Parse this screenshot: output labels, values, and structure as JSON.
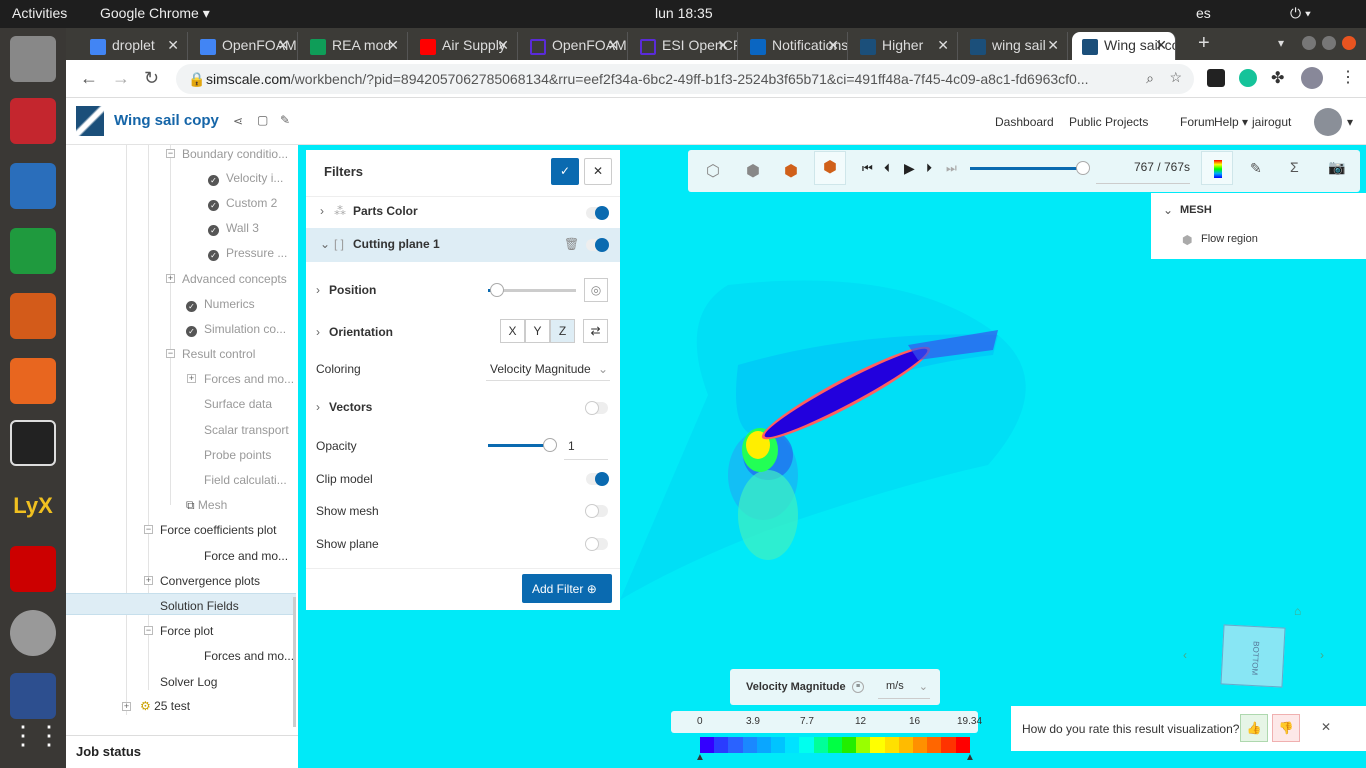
{
  "system": {
    "activities": "Activities",
    "app": "Google Chrome",
    "clock": "lun 18:35",
    "lang": "es"
  },
  "tabs": [
    {
      "label": "droplet",
      "color": "#4285f4"
    },
    {
      "label": "OpenFOAM",
      "color": "#4285f4"
    },
    {
      "label": "REA mod",
      "color": "#0f9d58"
    },
    {
      "label": "Air Supply",
      "color": "#ff0000"
    },
    {
      "label": "OpenFOAM",
      "color": "#5a2bd8"
    },
    {
      "label": "ESI OpenCFD",
      "color": "#5a2bd8"
    },
    {
      "label": "Notifications",
      "color": "#0a66c2"
    },
    {
      "label": "Higher",
      "color": "#1b4f7a"
    },
    {
      "label": "wing sail",
      "color": "#1b4f7a"
    },
    {
      "label": "Wing sail copy",
      "color": "#1b4f7a"
    }
  ],
  "browser": {
    "url_host": "simscale.com",
    "url_path": "/workbench/?pid=8942057062785068134&rru=eef2f34a-6bc2-49ff-b1f3-2524b3f65b71&ci=491ff48a-7f45-4c09-a8c1-fd6963cf0..."
  },
  "header": {
    "project": "Wing sail copy",
    "nav": [
      "Dashboard",
      "Public Projects",
      "Forum",
      "Help"
    ],
    "user": "jairogut"
  },
  "tree": {
    "boundary": "Boundary conditio...",
    "bc_items": [
      "Velocity i...",
      "Custom 2",
      "Wall 3",
      "Pressure ..."
    ],
    "advanced": "Advanced concepts",
    "numerics": "Numerics",
    "simcontrol": "Simulation co...",
    "result_control": "Result control",
    "rc_items": [
      "Forces and mo...",
      "Surface data",
      "Scalar transport",
      "Probe points",
      "Field calculati..."
    ],
    "mesh": "Mesh",
    "fcp": "Force coefficients plot",
    "fcp_child": "Force and mo...",
    "conv": "Convergence plots",
    "solution": "Solution Fields",
    "forceplot": "Force plot",
    "forceplot_child": "Forces and mo...",
    "solverlog": "Solver Log",
    "run": "25 test",
    "job_status": "Job status"
  },
  "filters": {
    "title": "Filters",
    "parts_color": "Parts Color",
    "cutting_plane": "Cutting plane 1",
    "position": "Position",
    "position_value": 0.05,
    "orientation": "Orientation",
    "axes": [
      "X",
      "Y",
      "Z"
    ],
    "coloring_label": "Coloring",
    "coloring_value": "Velocity Magnitude",
    "vectors": "Vectors",
    "opacity_label": "Opacity",
    "opacity_value": "1",
    "clip_model": "Clip model",
    "show_mesh": "Show mesh",
    "show_plane": "Show plane",
    "add_filter": "Add Filter"
  },
  "toolbar": {
    "time": "767 / 767s",
    "progress": 1.0
  },
  "mesh_panel": {
    "title": "MESH",
    "item": "Flow region"
  },
  "legend": {
    "field": "Velocity Magnitude",
    "unit": "m/s",
    "ticks": [
      "0",
      "3.9",
      "7.7",
      "12",
      "16",
      "19.34"
    ],
    "colors": [
      "#3300ff",
      "#2a3cff",
      "#2a62ff",
      "#1a88ff",
      "#0aa6ff",
      "#00c4ff",
      "#00e2ff",
      "#00ffee",
      "#00ff99",
      "#00ff44",
      "#22ee00",
      "#99ff00",
      "#ffff00",
      "#ffe000",
      "#ffbb00",
      "#ff9000",
      "#ff6600",
      "#ff3300",
      "#ff0000"
    ]
  },
  "cube_label": "BOTTOM",
  "rating": {
    "question": "How do you rate this result visualization?"
  }
}
